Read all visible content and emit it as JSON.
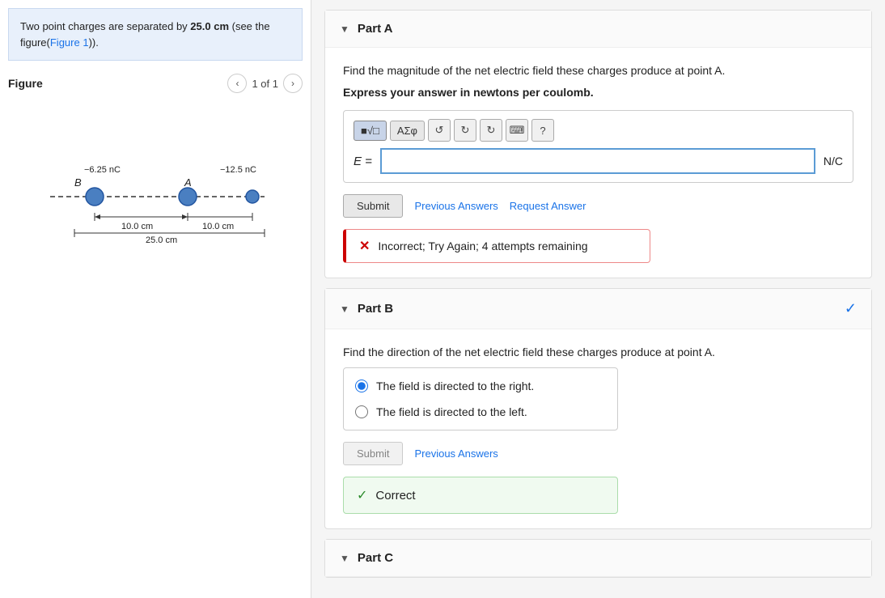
{
  "left": {
    "problem_text_pre": "Two point charges are separated by ",
    "problem_measurement": "25.0 cm",
    "problem_text_post": " (see the figure(",
    "figure_link": "Figure 1",
    "figure_link_suffix": ")).",
    "figure_title": "Figure",
    "figure_counter": "1 of 1",
    "charge_b_label": "B",
    "charge_a_label": "A",
    "charge_b_value": "−6.25 nC",
    "charge_a_value": "−12.5 nC",
    "dist_b": "10.0 cm",
    "dist_a": "10.0 cm",
    "dist_total": "25.0 cm"
  },
  "partA": {
    "label": "Part A",
    "question": "Find the magnitude of the net electric field these charges produce at point A.",
    "instruction": "Express your answer in newtons per coulomb.",
    "math_label": "E =",
    "unit": "N/C",
    "submit_label": "Submit",
    "previous_answers_label": "Previous Answers",
    "request_answer_label": "Request Answer",
    "error_text": "Incorrect; Try Again; 4 attempts remaining",
    "toolbar": {
      "btn1": "■√□",
      "btn2": "ΑΣφ",
      "undo": "↺",
      "redo": "↻",
      "reset": "↻",
      "keyboard": "⌨",
      "help": "?"
    }
  },
  "partB": {
    "label": "Part B",
    "question": "Find the direction of the net electric field these charges produce at point A.",
    "options": [
      "The field is directed to the right.",
      "The field is directed to the left."
    ],
    "selected_option": 0,
    "submit_label": "Submit",
    "previous_answers_label": "Previous Answers",
    "correct_text": "Correct",
    "is_correct": true
  },
  "partC": {
    "label": "Part C"
  },
  "icons": {
    "collapse": "▼",
    "checkmark": "✓",
    "incorrect_x": "✕",
    "correct_check": "✓",
    "prev_arrow": "‹",
    "next_arrow": "›"
  }
}
